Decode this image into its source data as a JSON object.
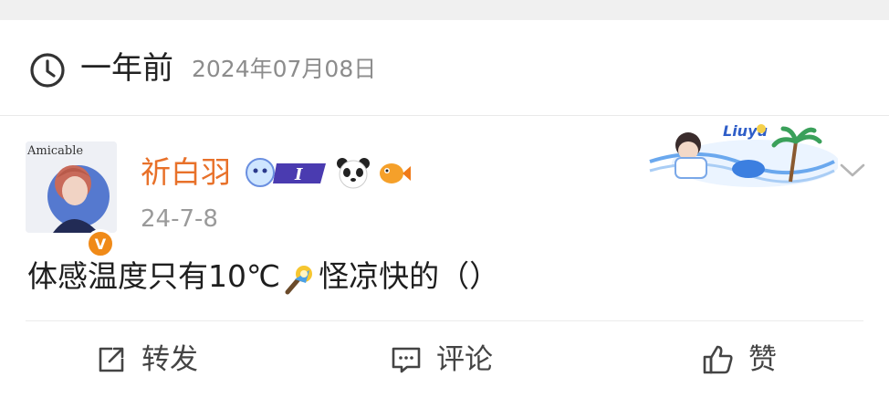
{
  "header": {
    "relative_time": "一年前",
    "absolute_date": "2024年07月08日"
  },
  "post": {
    "author": "祈白羽",
    "avatar_text": "Amicable",
    "verified_mark": "V",
    "badge_text": "I",
    "decoration_text": "Liuyu",
    "time": "24-7-8",
    "content_before": "体感温度只有10℃",
    "content_after": "怪凉快的（）"
  },
  "actions": {
    "repost_label": "转发",
    "comment_label": "评论",
    "like_label": "赞"
  },
  "colors": {
    "username": "#e8712a",
    "verified": "#f08a18",
    "muted_text": "#8c8c8c",
    "action_text": "#444444"
  },
  "icons": {
    "clock": "clock-icon",
    "chevron": "chevron-down-icon",
    "repost": "share-icon",
    "comment": "comment-icon",
    "like": "thumbs-up-icon",
    "inline_emoji": "lantern-emoji-icon"
  }
}
